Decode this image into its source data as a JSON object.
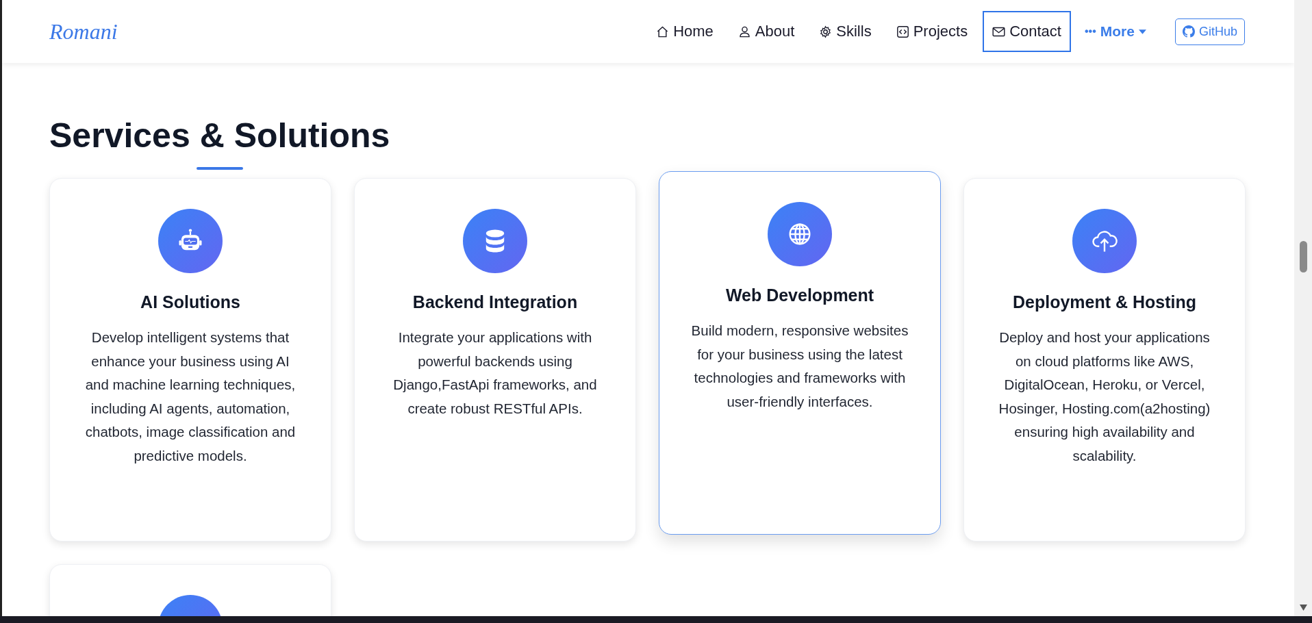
{
  "navbar": {
    "logo": "Romani",
    "links": [
      {
        "label": "Home",
        "kind": "home",
        "selected": false
      },
      {
        "label": "About",
        "kind": "person",
        "selected": false
      },
      {
        "label": "Skills",
        "kind": "gear",
        "selected": false
      },
      {
        "label": "Projects",
        "kind": "code",
        "selected": false
      },
      {
        "label": "Contact",
        "kind": "envelope",
        "selected": true
      }
    ],
    "more": {
      "icon": "•••",
      "label": "More"
    },
    "github": "GitHub"
  },
  "section": {
    "title": "Services & Solutions",
    "cards": [
      {
        "kind": "robot",
        "title": "AI Solutions",
        "description": "Develop intelligent systems that enhance your business using AI and machine learning techniques, including AI agents, automation, chatbots, image classification and predictive models.",
        "hovered": false
      },
      {
        "kind": "database",
        "title": "Backend Integration",
        "description": "Integrate your applications with powerful backends using Django,FastApi frameworks, and create robust RESTful APIs.",
        "hovered": false
      },
      {
        "kind": "globe",
        "title": "Web Development",
        "description": "Build modern, responsive websites for your business using the latest technologies and frameworks with user-friendly interfaces.",
        "hovered": true
      },
      {
        "kind": "cloud",
        "title": "Deployment & Hosting",
        "description": "Deploy and host your applications on cloud platforms like AWS, DigitalOcean, Heroku, or Vercel, Hosinger, Hosting.com(a2hosting) ensuring high availability and scalability.",
        "hovered": false
      },
      {
        "kind": "partial",
        "hovered": false
      }
    ]
  }
}
